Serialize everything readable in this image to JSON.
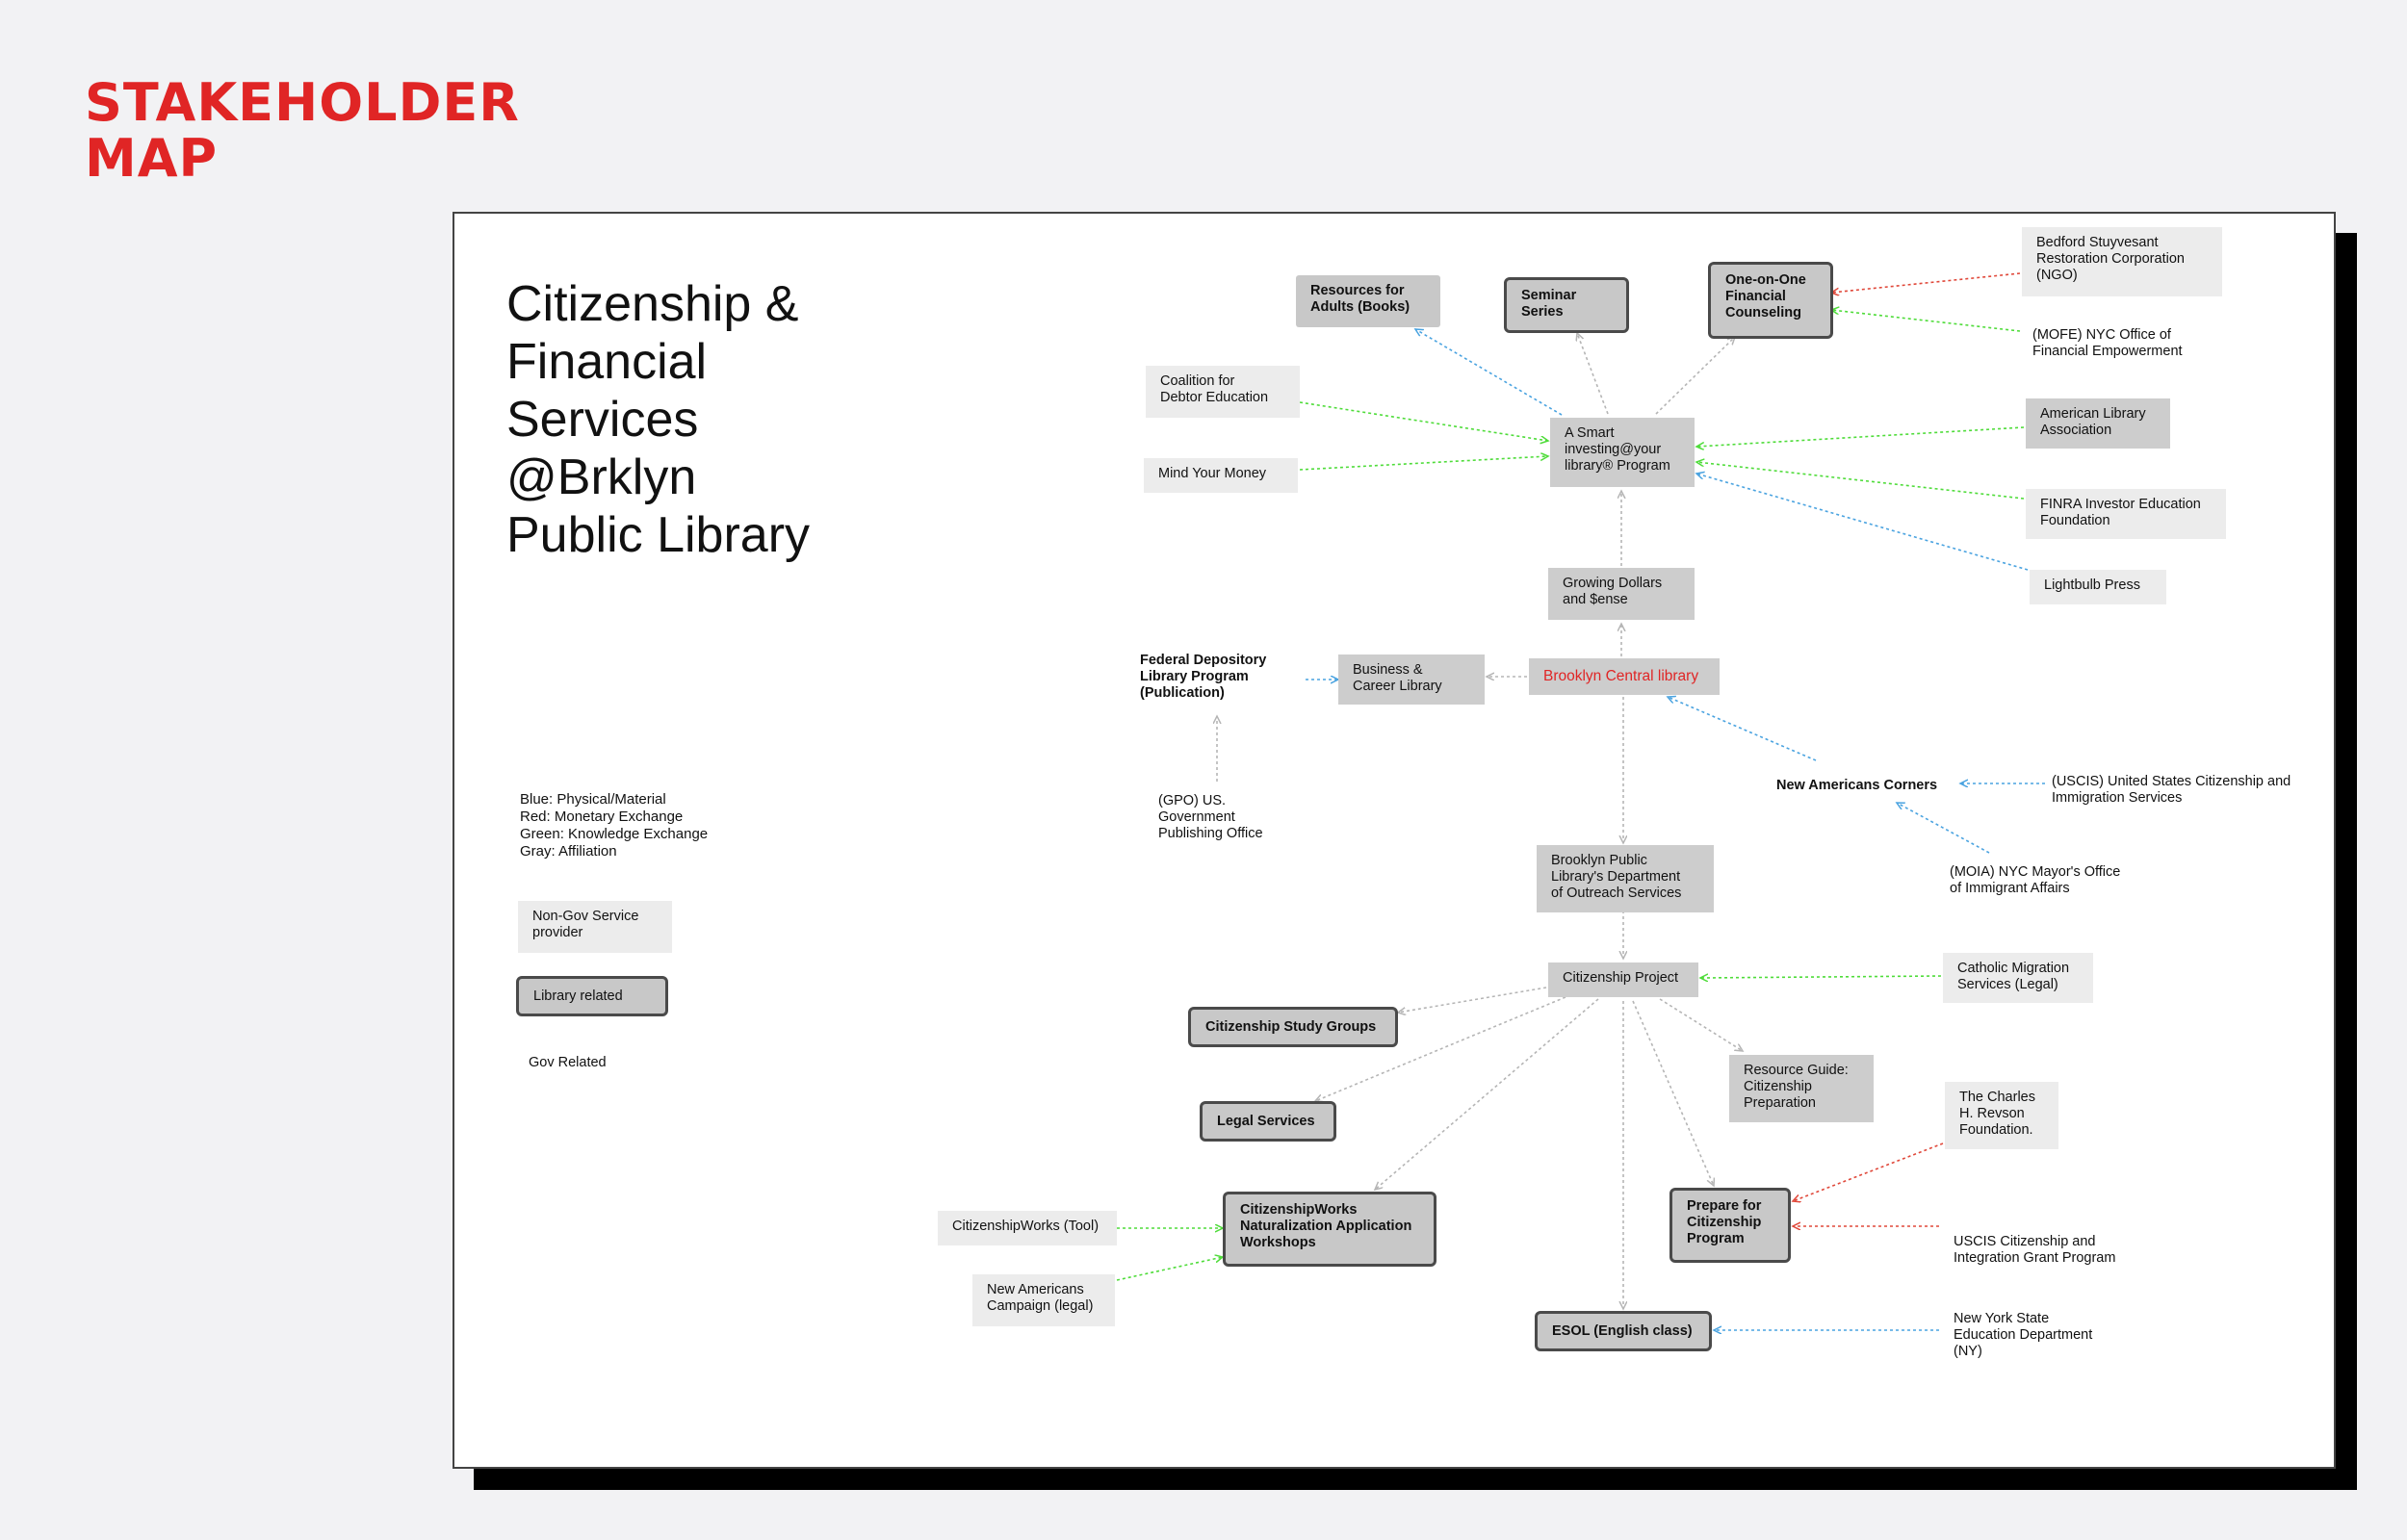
{
  "heading": "STAKEHOLDER\nMAP",
  "title": "Citizenship &\nFinancial\nServices\n@Brklyn\nPublic Library",
  "legend": {
    "lines": [
      "Blue: Physical/Material",
      "Red: Monetary Exchange",
      "Green: Knowledge Exchange",
      "Gray: Affiliation"
    ],
    "nongov_label": "Non-Gov Service\nprovider",
    "library_label": "Library related",
    "gov_label": "Gov Related"
  },
  "colors": {
    "blue": "#4aa3e0",
    "red": "#e0483a",
    "green": "#4fdc3a",
    "gray": "#b5b5b5",
    "accent": "#e02525"
  },
  "nodes": {
    "resources_books": "Resources for\nAdults (Books)",
    "seminar": "Seminar\nSeries",
    "one_on_one": "One-on-One\nFinancial\nCounseling",
    "bedford": "Bedford Stuyvesant\nRestoration Corporation\n(NGO)",
    "mofe": "(MOFE)  NYC Office of\nFinancial Empowerment",
    "coalition": "Coalition for\nDebtor Education",
    "smart": "A Smart\ninvesting@your\nlibrary® Program",
    "mind": "Mind Your Money",
    "ala": "American Library\nAssociation",
    "finra": "FINRA Investor Education\nFoundation",
    "lightbulb": "Lightbulb Press",
    "growing": "Growing Dollars\nand $ense",
    "federal": "Federal Depository\nLibrary Program\n(Publication)",
    "business": "Business &\nCareer Library",
    "central": "Brooklyn Central library",
    "gpo": "(GPO) US.\nGovernment\nPublishing Office",
    "new_americans_corners": "New Americans Corners",
    "uscis": "(USCIS) United States Citizenship and\nImmigration Services",
    "moia": "(MOIA) NYC Mayor's Office\nof Immigrant Affairs",
    "outreach": "Brooklyn Public\nLibrary's Department\nof Outreach Services",
    "citizenship_project": "Citizenship Project",
    "catholic": "Catholic Migration\nServices (Legal)",
    "study_groups": "Citizenship Study Groups",
    "legal": "Legal Services",
    "resource_guide": "Resource Guide:\nCitizenship\nPreparation",
    "revson": "The Charles\nH. Revson\nFoundation.",
    "cw_tool": "CitizenshipWorks (Tool)",
    "cw_workshops": "CitizenshipWorks\nNaturalization Application\nWorkshops",
    "prepare": "Prepare for\nCitizenship\nProgram",
    "uscis_grant": "USCIS Citizenship and\nIntegration Grant Program",
    "nac_legal": "New Americans\nCampaign (legal)",
    "esol": "ESOL (English class)",
    "nysed": "New York State\nEducation Department\n(NY)"
  }
}
